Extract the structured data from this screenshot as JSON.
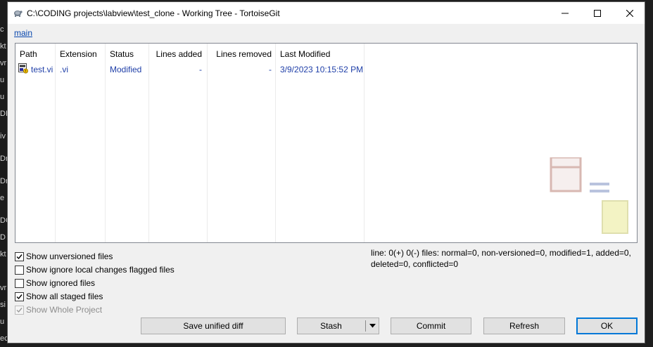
{
  "window": {
    "title": "C:\\CODING projects\\labview\\test_clone - Working Tree - TortoiseGit"
  },
  "branch": {
    "label": "main"
  },
  "file_list": {
    "columns": [
      "Path",
      "Extension",
      "Status",
      "Lines added",
      "Lines removed",
      "Last Modified"
    ],
    "rows": [
      {
        "path": "test.vi",
        "extension": ".vi",
        "status": "Modified",
        "lines_added": "-",
        "lines_removed": "-",
        "last_modified": "3/9/2023 10:15:52 PM"
      }
    ]
  },
  "options": [
    {
      "label": "Show unversioned files",
      "checked": true,
      "enabled": true
    },
    {
      "label": "Show ignore local changes flagged files",
      "checked": false,
      "enabled": true
    },
    {
      "label": "Show ignored files",
      "checked": false,
      "enabled": true
    },
    {
      "label": "Show all staged files",
      "checked": true,
      "enabled": true
    },
    {
      "label": "Show Whole Project",
      "checked": true,
      "enabled": false
    }
  ],
  "status_summary": "line: 0(+) 0(-) files: normal=0, non-versioned=0, modified=1, added=0, deleted=0, conflicted=0",
  "buttons": {
    "save_unified_diff": "Save unified diff",
    "stash": "Stash",
    "commit": "Commit",
    "refresh": "Refresh",
    "ok": "OK"
  },
  "colors": {
    "link": "#0645ad",
    "row_text": "#1f3fa8",
    "default_button_border": "#0078d7"
  },
  "background_app_fragments": [
    "c",
    "kt",
    "vr",
    "u",
    "u",
    "DI",
    "iv",
    "Dr",
    "Dr",
    "e",
    "DC",
    "D",
    "kt",
    "vr",
    "si",
    "u",
    "ec"
  ]
}
